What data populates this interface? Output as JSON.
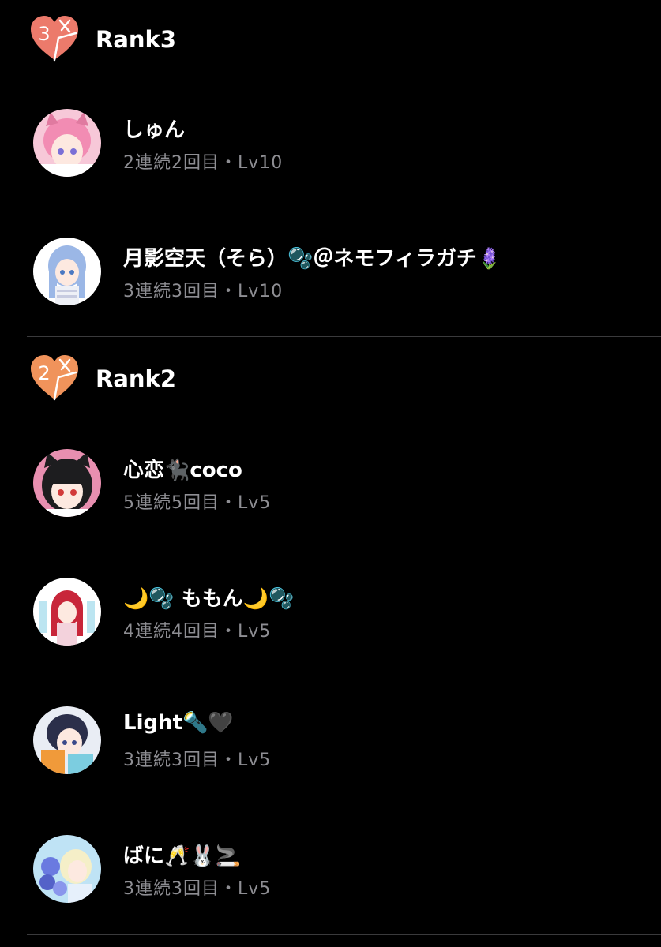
{
  "colors": {
    "background": "#000000",
    "primary_text": "#ffffff",
    "secondary_text": "#8e8e93",
    "divider": "#3a3a3c",
    "rank3_badge": "#ec7a6b",
    "rank2_badge": "#f0935b"
  },
  "sections": [
    {
      "badge_number": "3",
      "title": "Rank3",
      "users": [
        {
          "name": "しゅん",
          "meta": "2連続2回目・Lv10"
        },
        {
          "name": "月影空天（そら）🫧＠ネモフィラガチ🪻",
          "meta": "3連続3回目・Lv10"
        }
      ]
    },
    {
      "badge_number": "2",
      "title": "Rank2",
      "users": [
        {
          "name": "心恋🐈‍⬛coco",
          "meta": "5連続5回目・Lv5"
        },
        {
          "name": "🌙🫧 ももん🌙🫧",
          "meta": "4連続4回目・Lv5"
        },
        {
          "name": "Light🔦🖤",
          "meta": "3連続3回目・Lv5"
        },
        {
          "name": "ばに🥂🐰🚬",
          "meta": "3連続3回目・Lv5"
        }
      ]
    }
  ]
}
